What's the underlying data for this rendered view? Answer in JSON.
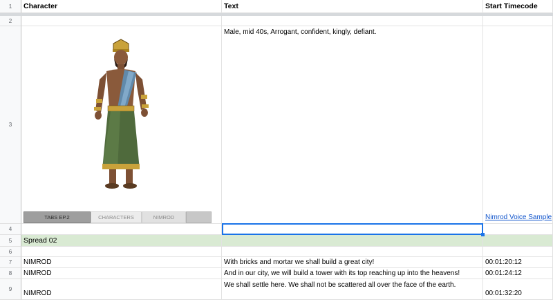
{
  "headers": {
    "row": "1",
    "col_a": "Character",
    "col_b": "Text",
    "col_c": "Start Timecode"
  },
  "rows": {
    "r2": {
      "num": "2"
    },
    "r3": {
      "num": "3",
      "text": "Male, mid 40s, Arrogant, confident, kingly, defiant.",
      "link": "Nimrod Voice Sample",
      "image_tabs": [
        "TABS EP.2",
        "CHARACTERS",
        "NIMROD"
      ]
    },
    "r4": {
      "num": "4"
    },
    "r5": {
      "num": "5",
      "label": "Spread 02"
    },
    "r6": {
      "num": "6"
    },
    "r7": {
      "num": "7",
      "character": "NIMROD",
      "text": "With bricks and mortar we shall build a great city!",
      "timecode": "00:01:20:12"
    },
    "r8": {
      "num": "8",
      "character": "NIMROD",
      "text": "And in our city, we will build a tower with its top reaching up into the heavens!",
      "timecode": "00:01:24:12"
    },
    "r9": {
      "num": "9",
      "character": "NIMROD",
      "text": "We shall settle here. We shall not be scattered all over the face of the earth.",
      "timecode": "00:01:32:20"
    }
  },
  "colors": {
    "accent": "#1a73e8",
    "link": "#1155cc",
    "section_fill": "#d9ead3"
  },
  "icons": {
    "figure": "warrior-king-illustration"
  }
}
